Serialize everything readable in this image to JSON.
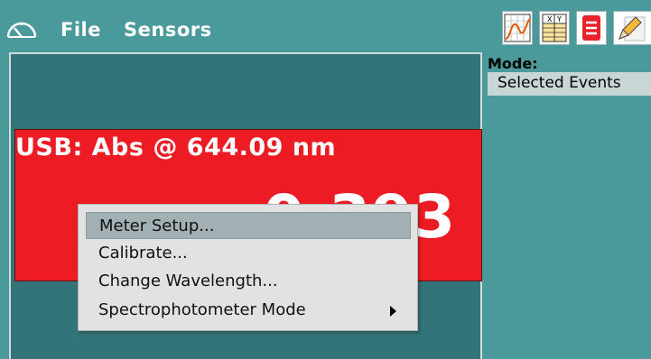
{
  "menubar": {
    "app_icon": "meter-gauge-icon",
    "items": [
      {
        "label": "File"
      },
      {
        "label": "Sensors"
      }
    ]
  },
  "toolbar": {
    "buttons": [
      {
        "icon": "graph-view-icon"
      },
      {
        "icon": "table-view-icon"
      },
      {
        "icon": "notes-view-icon"
      },
      {
        "icon": "pencil-icon"
      }
    ]
  },
  "meter": {
    "title": "USB: Abs @ 644.09 nm",
    "value": "0.393",
    "bg_color": "#ed1c24"
  },
  "mode_panel": {
    "label": "Mode:",
    "selected": "Selected Events"
  },
  "context_menu": {
    "items": [
      {
        "label": "Meter Setup...",
        "highlighted": true
      },
      {
        "label": "Calibrate..."
      },
      {
        "label": "Change Wavelength..."
      },
      {
        "label": "Spectrophotometer Mode",
        "submenu": true
      }
    ]
  }
}
